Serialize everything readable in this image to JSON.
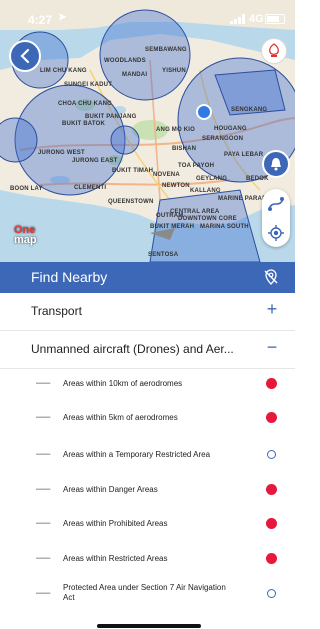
{
  "status_bar": {
    "time": "4:27",
    "network": "4G"
  },
  "map": {
    "labels": [
      "SEMBAWANG",
      "WOODLANDS",
      "MANDAI",
      "YISHUN",
      "LIM CHU KANG",
      "SUNGEI KADUT",
      "CHOA CHU KANG",
      "BUKIT BATOK",
      "BUKIT PANJANG",
      "JURONG WEST",
      "JURONG EAST",
      "BOON LAY",
      "CLEMENTI",
      "BUKIT TIMAH",
      "QUEENSTOWN",
      "NOVENA",
      "TOA PAYOH",
      "BISHAN",
      "ANG MO KIO",
      "SERANGOON",
      "HOUGANG",
      "SENGKANG",
      "PAYA LEBAR",
      "NEWTON",
      "KALLANG",
      "CENTRAL AREA",
      "DOWNTOWN CORE",
      "MARINA SOUTH",
      "MARINE PARADE",
      "OUTRAM",
      "BUKIT MERAH",
      "GEYLANG",
      "BEDOK",
      "SENTOSA"
    ],
    "logo": {
      "part1": "One",
      "part2": "map"
    }
  },
  "panel": {
    "title": "Find Nearby",
    "categories": [
      {
        "label": "Transport",
        "toggle": "+"
      },
      {
        "label": "Unmanned aircraft (Drones) and Aer...",
        "toggle": "−"
      }
    ],
    "layers": [
      {
        "icon": "▬▬▬",
        "name": "Areas within 10km of aerodromes",
        "state": "on"
      },
      {
        "icon": "▬▬▬",
        "name": "Areas within 5km of aerodromes",
        "state": "on"
      },
      {
        "icon": "▬▬▬",
        "name": "Areas within a Temporary Restricted Area",
        "state": "off"
      },
      {
        "icon": "▬▬▬",
        "name": "Areas within Danger Areas",
        "state": "on"
      },
      {
        "icon": "▬▬▬",
        "name": "Areas within Prohibited Areas",
        "state": "on"
      },
      {
        "icon": "▬▬▬",
        "name": "Areas within Restricted Areas",
        "state": "on"
      },
      {
        "icon": "▬▬▬",
        "name": "Protected Area under Section 7 Air Navigation Act",
        "state": "off"
      }
    ]
  },
  "colors": {
    "accent": "#3d68b8",
    "on": "#e8173c",
    "zone": "#3d6bd1"
  }
}
